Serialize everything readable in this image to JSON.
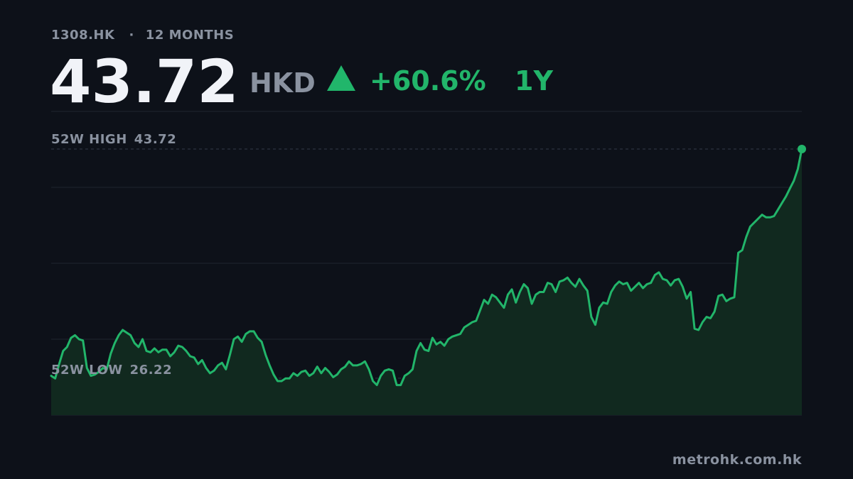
{
  "header": {
    "ticker": "1308.HK",
    "separator": "·",
    "range": "12 MONTHS",
    "price": "43.72",
    "currency": "HKD",
    "change": "+60.6%",
    "period": "1Y"
  },
  "labels": {
    "high_text": "52W HIGH",
    "high_value": "43.72",
    "low_text": "52W LOW",
    "low_value": "26.22"
  },
  "footer": {
    "source": "metrohk.com.hk"
  },
  "colors": {
    "background": "#0d1119",
    "accent_up": "#22b56a",
    "muted": "#8a92a0",
    "price": "#f1f3f8"
  },
  "chart_data": {
    "type": "area",
    "title": "",
    "xlabel": "",
    "ylabel": "",
    "ylim": [
      23.4,
      43.72
    ],
    "high": 43.72,
    "low": 26.22,
    "series": [
      {
        "values": [
          26.4,
          26.2,
          27.3,
          28.3,
          28.6,
          29.3,
          29.5,
          29.2,
          29.1,
          27.0,
          26.4,
          26.5,
          26.7,
          27.0,
          26.9,
          28.1,
          28.9,
          29.5,
          29.9,
          29.7,
          29.5,
          28.9,
          28.6,
          29.2,
          28.3,
          28.2,
          28.5,
          28.2,
          28.4,
          28.4,
          27.9,
          28.2,
          28.7,
          28.6,
          28.3,
          27.9,
          27.8,
          27.3,
          27.6,
          27.0,
          26.6,
          26.8,
          27.2,
          27.4,
          26.9,
          28.0,
          29.2,
          29.4,
          29.0,
          29.6,
          29.8,
          29.8,
          29.3,
          29.0,
          28.0,
          27.2,
          26.5,
          26.0,
          26.0,
          26.2,
          26.2,
          26.6,
          26.4,
          26.7,
          26.8,
          26.4,
          26.6,
          27.1,
          26.6,
          27.0,
          26.7,
          26.3,
          26.5,
          26.9,
          27.1,
          27.5,
          27.2,
          27.2,
          27.3,
          27.5,
          26.9,
          26.0,
          25.7,
          26.4,
          26.8,
          26.9,
          26.8,
          25.7,
          25.7,
          26.4,
          26.6,
          26.9,
          28.3,
          28.9,
          28.4,
          28.3,
          29.3,
          28.8,
          29.0,
          28.7,
          29.2,
          29.4,
          29.5,
          29.6,
          30.1,
          30.3,
          30.5,
          30.6,
          31.4,
          32.2,
          31.9,
          32.6,
          32.4,
          32.0,
          31.6,
          32.6,
          33.0,
          32.0,
          32.8,
          33.4,
          33.1,
          31.9,
          32.6,
          32.8,
          32.8,
          33.5,
          33.4,
          32.8,
          33.6,
          33.7,
          33.9,
          33.5,
          33.2,
          33.8,
          33.3,
          32.9,
          30.9,
          30.3,
          31.6,
          32.0,
          31.9,
          32.8,
          33.3,
          33.6,
          33.4,
          33.5,
          32.9,
          33.2,
          33.5,
          33.1,
          33.4,
          33.5,
          34.1,
          34.3,
          33.8,
          33.7,
          33.3,
          33.7,
          33.8,
          33.2,
          32.3,
          32.8,
          30.0,
          29.9,
          30.5,
          30.9,
          30.8,
          31.3,
          32.5,
          32.6,
          32.1,
          32.3,
          32.4,
          35.8,
          36.0,
          37.0,
          37.8,
          38.1,
          38.4,
          38.7,
          38.5,
          38.5,
          38.6,
          39.1,
          39.6,
          40.1,
          40.7,
          41.3,
          42.2,
          43.72
        ]
      }
    ]
  }
}
